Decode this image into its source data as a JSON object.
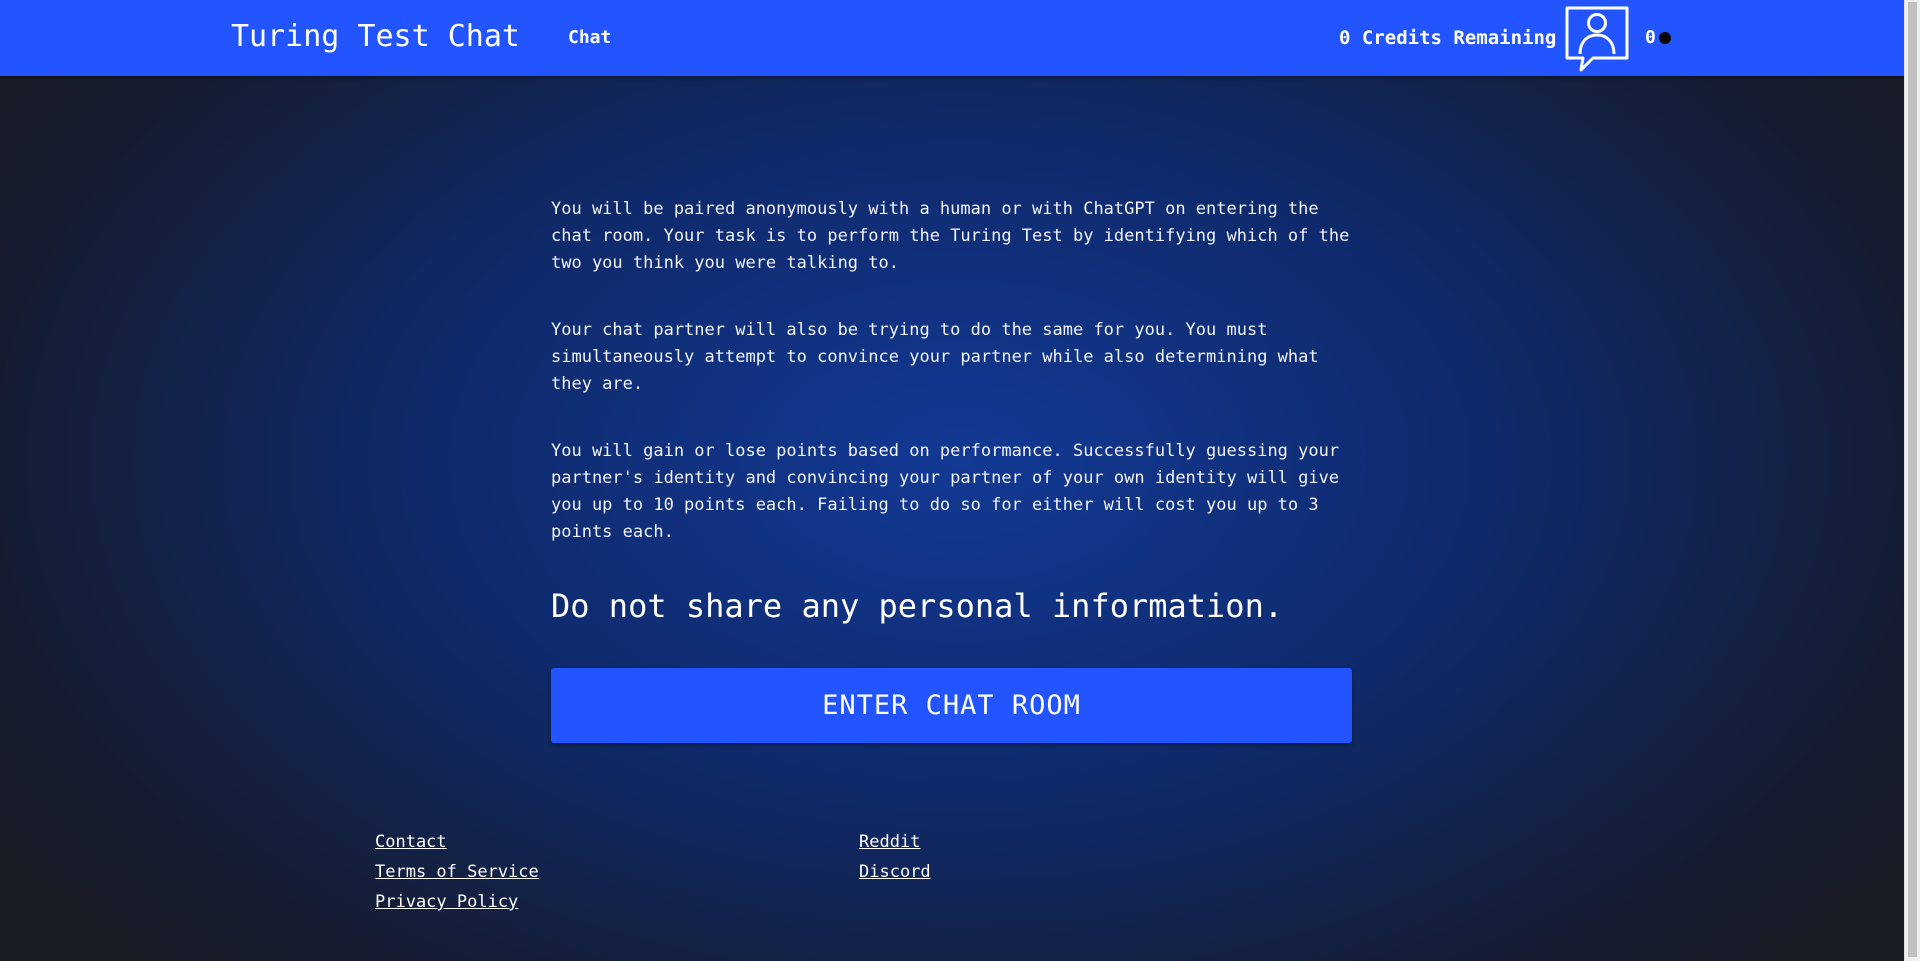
{
  "header": {
    "brand": "Turing Test Chat",
    "nav_chat": "Chat",
    "credits": "0 Credits Remaining",
    "avatar_icon": "user-chat-bubble-icon",
    "count": "0",
    "status_dot_color": "#050505"
  },
  "main": {
    "paragraphs": [
      "You will be paired anonymously with a human or with ChatGPT on entering the chat room. Your task is to perform the Turing Test by identifying which of the two you think you were talking to.",
      "Your chat partner will also be trying to do the same for you. You must simultaneously attempt to convince your partner while also determining what they are.",
      "You will gain or lose points based on performance. Successfully guessing your partner's identity and convincing your partner of your own identity will give you up to 10 points each. Failing to do so for either will cost you up to 3 points each."
    ],
    "warning": "Do not share any personal information.",
    "enter_button": "ENTER CHAT ROOM"
  },
  "footer": {
    "contact": "Contact",
    "terms": "Terms of Service",
    "privacy": "Privacy Policy",
    "reddit": "Reddit",
    "discord": "Discord"
  },
  "colors": {
    "accent": "#2255ff",
    "background_center": "#123994",
    "background_edge": "#1a1c24"
  }
}
